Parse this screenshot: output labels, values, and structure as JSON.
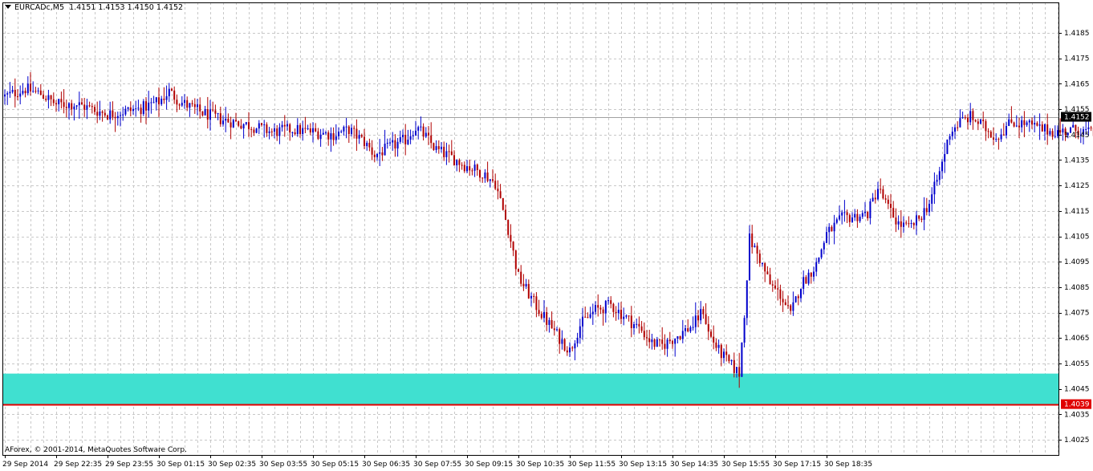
{
  "header": {
    "symbol": "EURCADc,M5",
    "ohlc": "1.4151 1.4153 1.4150 1.4152"
  },
  "copyright": "AForex, © 2001-2014, MetaQuotes Software Corp.",
  "colors": {
    "bull": "#0000cc",
    "bear": "#b00000",
    "zone": "#40e0d0",
    "support": "#e00000",
    "grid": "#c8c8c8",
    "current_price_bg": "#000000",
    "support_tag_bg": "#e00000"
  },
  "chart_data": {
    "type": "candlestick",
    "symbol": "EURCADc",
    "timeframe": "M5",
    "ylim": [
      1.4019,
      1.4197
    ],
    "y_ticks": [
      "1.4185",
      "1.4175",
      "1.4165",
      "1.4155",
      "1.4145",
      "1.4135",
      "1.4125",
      "1.4115",
      "1.4105",
      "1.4095",
      "1.4085",
      "1.4075",
      "1.4065",
      "1.4055",
      "1.4045",
      "1.4035",
      "1.4025"
    ],
    "x_ticks": [
      "29 Sep 2014",
      "29 Sep 22:35",
      "29 Sep 23:55",
      "30 Sep 01:15",
      "30 Sep 02:35",
      "30 Sep 03:55",
      "30 Sep 05:15",
      "30 Sep 06:35",
      "30 Sep 07:55",
      "30 Sep 09:15",
      "30 Sep 10:35",
      "30 Sep 11:55",
      "30 Sep 13:15",
      "30 Sep 14:35",
      "30 Sep 15:55",
      "30 Sep 17:15",
      "30 Sep 18:35"
    ],
    "current_price": "1.4152",
    "support_price": "1.4039",
    "zone": [
      1.4039,
      1.4051
    ],
    "path": [
      [
        0,
        1.416
      ],
      [
        8,
        1.4163
      ],
      [
        14,
        1.4161
      ],
      [
        20,
        1.4157
      ],
      [
        28,
        1.4157
      ],
      [
        40,
        1.4153
      ],
      [
        52,
        1.4155
      ],
      [
        60,
        1.4158
      ],
      [
        64,
        1.4162
      ],
      [
        68,
        1.4158
      ],
      [
        76,
        1.4154
      ],
      [
        84,
        1.4151
      ],
      [
        94,
        1.4149
      ],
      [
        104,
        1.4146
      ],
      [
        112,
        1.4147
      ],
      [
        120,
        1.4146
      ],
      [
        128,
        1.4145
      ],
      [
        134,
        1.4147
      ],
      [
        140,
        1.4142
      ],
      [
        144,
        1.4137
      ],
      [
        150,
        1.414
      ],
      [
        156,
        1.4143
      ],
      [
        160,
        1.4148
      ],
      [
        164,
        1.4144
      ],
      [
        168,
        1.4139
      ],
      [
        174,
        1.4136
      ],
      [
        179,
        1.4133
      ],
      [
        186,
        1.413
      ],
      [
        191,
        1.4126
      ],
      [
        196,
        1.4108
      ],
      [
        200,
        1.4089
      ],
      [
        206,
        1.4079
      ],
      [
        210,
        1.4073
      ],
      [
        216,
        1.4065
      ],
      [
        220,
        1.406
      ],
      [
        224,
        1.407
      ],
      [
        230,
        1.4076
      ],
      [
        236,
        1.4078
      ],
      [
        242,
        1.4073
      ],
      [
        248,
        1.4068
      ],
      [
        252,
        1.4063
      ],
      [
        256,
        1.4062
      ],
      [
        262,
        1.4066
      ],
      [
        268,
        1.407
      ],
      [
        272,
        1.4076
      ],
      [
        274,
        1.4067
      ],
      [
        278,
        1.406
      ],
      [
        282,
        1.4055
      ],
      [
        286,
        1.4051
      ],
      [
        288,
        1.4075
      ],
      [
        290,
        1.4104
      ],
      [
        294,
        1.4096
      ],
      [
        298,
        1.4086
      ],
      [
        302,
        1.4082
      ],
      [
        306,
        1.4074
      ],
      [
        310,
        1.4086
      ],
      [
        316,
        1.4094
      ],
      [
        320,
        1.4106
      ],
      [
        326,
        1.4112
      ],
      [
        332,
        1.4113
      ],
      [
        336,
        1.4114
      ],
      [
        340,
        1.4124
      ],
      [
        344,
        1.4116
      ],
      [
        348,
        1.411
      ],
      [
        352,
        1.4108
      ],
      [
        356,
        1.4112
      ],
      [
        360,
        1.4118
      ],
      [
        364,
        1.413
      ],
      [
        368,
        1.4146
      ],
      [
        372,
        1.415
      ],
      [
        376,
        1.4152
      ],
      [
        380,
        1.4149
      ],
      [
        386,
        1.4144
      ],
      [
        392,
        1.415
      ],
      [
        398,
        1.4149
      ],
      [
        404,
        1.4147
      ],
      [
        410,
        1.4146
      ],
      [
        418,
        1.4147
      ],
      [
        424,
        1.4145
      ],
      [
        430,
        1.4148
      ],
      [
        434,
        1.4152
      ]
    ]
  }
}
